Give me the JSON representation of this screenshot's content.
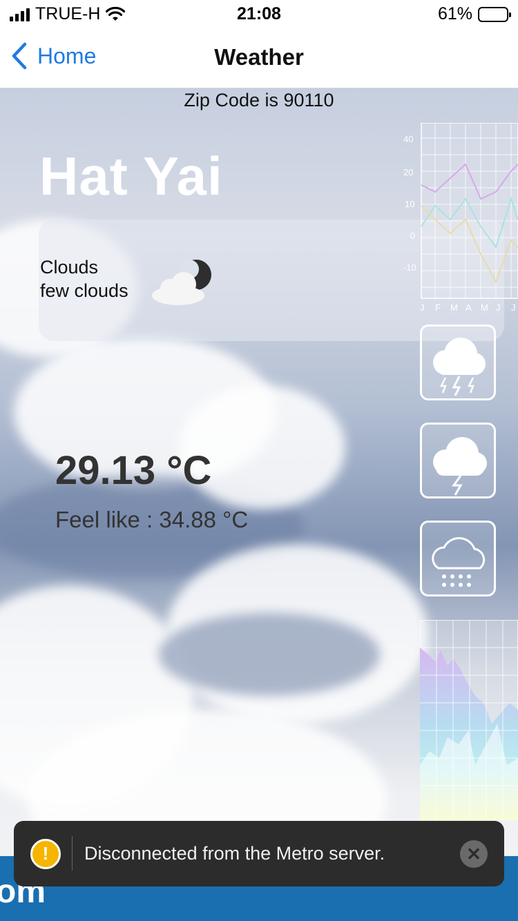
{
  "status_bar": {
    "carrier": "TRUE-H",
    "time": "21:08",
    "battery_percent": "61%",
    "battery_level": 0.61,
    "icons": [
      "signal-icon",
      "wifi-icon",
      "battery-icon"
    ]
  },
  "nav": {
    "back_label": "Home",
    "title": "Weather",
    "back_icon": "chevron-left-icon"
  },
  "weather": {
    "zip_text": "Zip Code is 90110",
    "city": "Hat Yai",
    "condition_main": "Clouds",
    "condition_desc": "few clouds",
    "condition_icon": "cloud-moon-icon",
    "temperature": "29.13 °C",
    "feels_like": "Feel like : 34.88 °C"
  },
  "decor_chart": {
    "y_ticks": [
      "40",
      "20",
      "10",
      "0",
      "-10"
    ],
    "x_ticks": [
      "J",
      "F",
      "M",
      "A",
      "M",
      "J",
      "J"
    ]
  },
  "tiles": [
    "thunderstorm-icon",
    "lightning-cloud-icon",
    "snow-cloud-icon"
  ],
  "bottom_strip": {
    "text": "om"
  },
  "toast": {
    "message": "Disconnected from the Metro server.",
    "icon": "warning-icon",
    "close_icon": "close-icon"
  },
  "colors": {
    "accent": "#1f7ae0",
    "toast_bg": "#2c2c2c",
    "warning": "#f5b500",
    "bottom_strip": "#1a6fb0"
  }
}
